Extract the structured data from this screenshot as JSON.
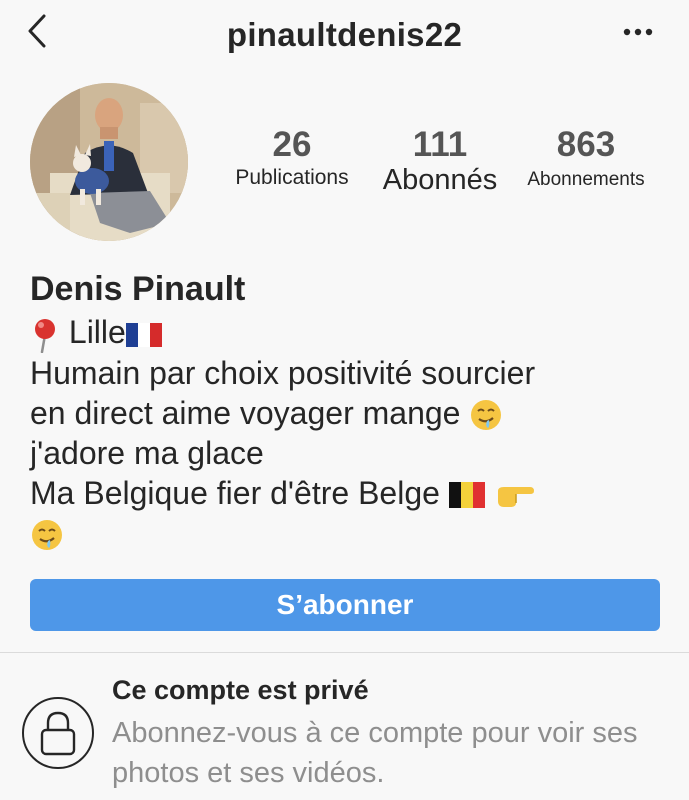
{
  "header": {
    "username": "pinaultdenis22",
    "back_icon": "chevron-left-icon",
    "more_icon": "ellipsis-icon"
  },
  "stats": {
    "publications": {
      "value": "26",
      "label": "Publications"
    },
    "followers": {
      "value": "111",
      "label": "Abonnés"
    },
    "following": {
      "value": "863",
      "label": "Abonnements"
    }
  },
  "profile": {
    "display_name": "Denis Pinault",
    "bio": {
      "line1_text": "Lille",
      "line2": "Humain par choix positivité sourcier",
      "line3_text": "en direct aime voyager mange",
      "line4": "j'adore ma glace",
      "line5_text": "Ma Belgique fier d'être Belge"
    }
  },
  "actions": {
    "subscribe_label": "S’abonner",
    "accent_color": "#4e97e8"
  },
  "private_notice": {
    "title": "Ce compte est privé",
    "description": "Abonnez-vous à ce compte pour voir ses photos et ses vidéos.",
    "icon": "lock-icon"
  }
}
